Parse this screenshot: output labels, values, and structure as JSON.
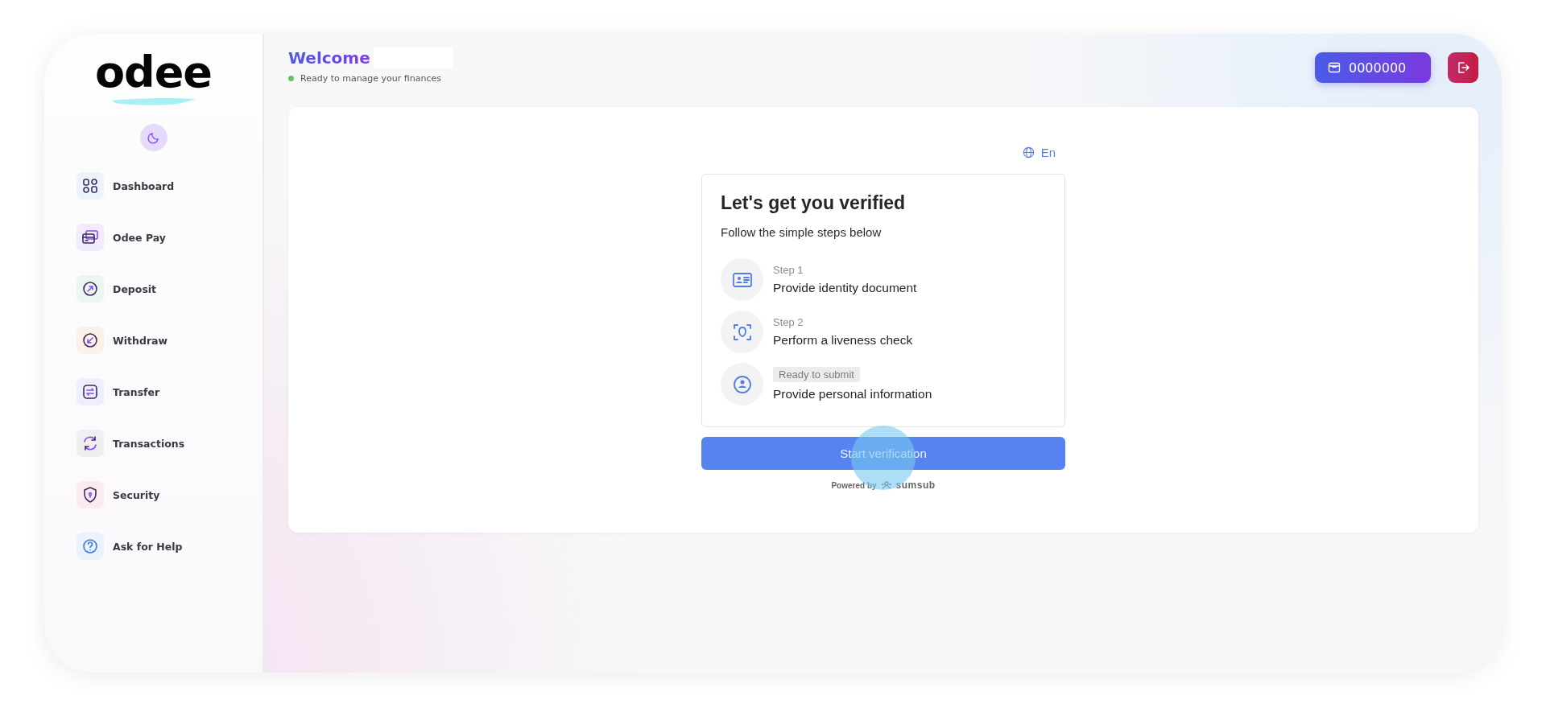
{
  "sidebar": {
    "logo": "odee",
    "theme_toggle": {
      "dark": false
    },
    "items": [
      {
        "label": "Dashboard",
        "color": "#eef2fb"
      },
      {
        "label": "Odee Pay",
        "color": "#f1ebfd"
      },
      {
        "label": "Deposit",
        "color": "#ecf5f1"
      },
      {
        "label": "Withdraw",
        "color": "#fcf1e7"
      },
      {
        "label": "Transfer",
        "color": "#eeeefc"
      },
      {
        "label": "Transactions",
        "color": "#efeff2"
      },
      {
        "label": "Security",
        "color": "#fbebf1"
      },
      {
        "label": "Ask for Help",
        "color": "#ebf2fb"
      }
    ]
  },
  "header": {
    "title": "Welcome",
    "status": "Ready to manage your finances",
    "balance": "0000000"
  },
  "verification": {
    "language": "En",
    "title": "Let's get you verified",
    "subtitle": "Follow the simple steps below",
    "steps": [
      {
        "kind": "numbered",
        "label": "Step 1",
        "title": "Provide identity document"
      },
      {
        "kind": "numbered",
        "label": "Step 2",
        "title": "Perform a liveness check"
      },
      {
        "kind": "badge",
        "label": "Ready to submit",
        "title": "Provide personal information"
      }
    ],
    "button": "Start verification",
    "powered_by": "Powered by",
    "provider": "sumsub"
  }
}
